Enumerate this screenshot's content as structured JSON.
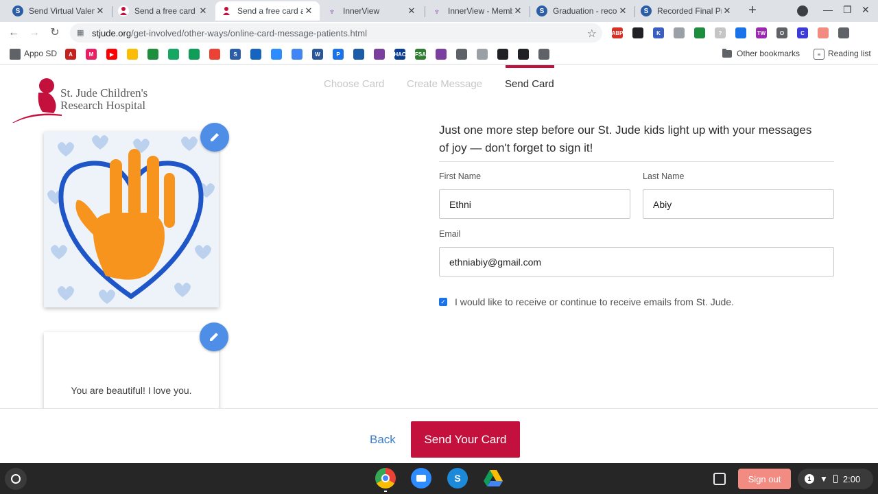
{
  "browser": {
    "tabs": [
      {
        "title": "Send Virtual Valen",
        "favicon_color": "#2b5ea7",
        "favicon_letter": "S",
        "active": false
      },
      {
        "title": "Send a free card a",
        "favicon_color": "#c4103d",
        "favicon_letter": "",
        "active": false
      },
      {
        "title": "Send a free card a",
        "favicon_color": "#c4103d",
        "favicon_letter": "",
        "active": true
      },
      {
        "title": "InnerView",
        "favicon_color": "#7b3fa0",
        "favicon_letter": "",
        "active": false
      },
      {
        "title": "InnerView - Memb",
        "favicon_color": "#7b3fa0",
        "favicon_letter": "",
        "active": false
      },
      {
        "title": "Graduation - recor",
        "favicon_color": "#2b5ea7",
        "favicon_letter": "S",
        "active": false
      },
      {
        "title": "Recorded Final Pr",
        "favicon_color": "#2b5ea7",
        "favicon_letter": "S",
        "active": false
      }
    ],
    "url_domain": "stjude.org",
    "url_path": "/get-involved/other-ways/online-card-message-patients.html",
    "extensions": [
      {
        "label": "ABP",
        "color": "#d93025"
      },
      {
        "label": "",
        "color": "#202124"
      },
      {
        "label": "K",
        "color": "#3b5fc0"
      },
      {
        "label": "",
        "color": "#9aa0a6"
      },
      {
        "label": "",
        "color": "#1e8e3e"
      },
      {
        "label": "?",
        "color": "#c5c5c5"
      },
      {
        "label": "",
        "color": "#1a73e8"
      },
      {
        "label": "TW",
        "color": "#9c27b0"
      },
      {
        "label": "O",
        "color": "#5f6368"
      },
      {
        "label": "C",
        "color": "#3d3bd9"
      },
      {
        "label": "",
        "color": "#f28b82"
      },
      {
        "label": "",
        "color": "#5f6368"
      }
    ],
    "bookmarks": {
      "apps_label": "Appo SD",
      "icons": [
        {
          "color": "#c5221f",
          "label": "A"
        },
        {
          "color": "#e91e63",
          "label": "M"
        },
        {
          "color": "#ff0000",
          "label": "▶"
        },
        {
          "color": "#fbbc04",
          "label": ""
        },
        {
          "color": "#1e8e3e",
          "label": ""
        },
        {
          "color": "#16a765",
          "label": ""
        },
        {
          "color": "#0f9d58",
          "label": ""
        },
        {
          "color": "#ea4335",
          "label": ""
        },
        {
          "color": "#2b5ea7",
          "label": "S"
        },
        {
          "color": "#1565c0",
          "label": ""
        },
        {
          "color": "#2d8cff",
          "label": ""
        },
        {
          "color": "#4285f4",
          "label": ""
        },
        {
          "color": "#2b579a",
          "label": "W"
        },
        {
          "color": "#1a73e8",
          "label": "P"
        },
        {
          "color": "#1c5ba8",
          "label": ""
        },
        {
          "color": "#7b3fa0",
          "label": ""
        },
        {
          "color": "#0b3d91",
          "label": "HAC"
        },
        {
          "color": "#2e7d32",
          "label": "FSA"
        },
        {
          "color": "#7b3fa0",
          "label": ""
        },
        {
          "color": "#5f6368",
          "label": ""
        },
        {
          "color": "#9aa0a6",
          "label": ""
        },
        {
          "color": "#202124",
          "label": ""
        },
        {
          "color": "#202124",
          "label": ""
        },
        {
          "color": "#5f6368",
          "label": ""
        }
      ],
      "other": "Other bookmarks",
      "reading_list": "Reading list"
    }
  },
  "page": {
    "logo_line1": "St. Jude Children's",
    "logo_line2": "Research Hospital",
    "steps": [
      "Choose Card",
      "Create Message",
      "Send Card"
    ],
    "card_message": "You are beautiful! I love you.",
    "prompt": "Just one more step before our St. Jude kids light up with your messages of joy — don't forget to sign it!",
    "first_name_label": "First Name",
    "first_name_value": "Ethni",
    "last_name_label": "Last Name",
    "last_name_value": "Abiy",
    "email_label": "Email",
    "email_value": "ethniabiy@gmail.com",
    "checkbox_label": "I would like to receive or continue to receive emails from St. Jude.",
    "checkbox_checked": true,
    "back_label": "Back",
    "send_label": "Send Your Card",
    "brand_color": "#c4103d"
  },
  "shelf": {
    "sign_out": "Sign out",
    "notification_count": "1",
    "time": "2:00"
  }
}
